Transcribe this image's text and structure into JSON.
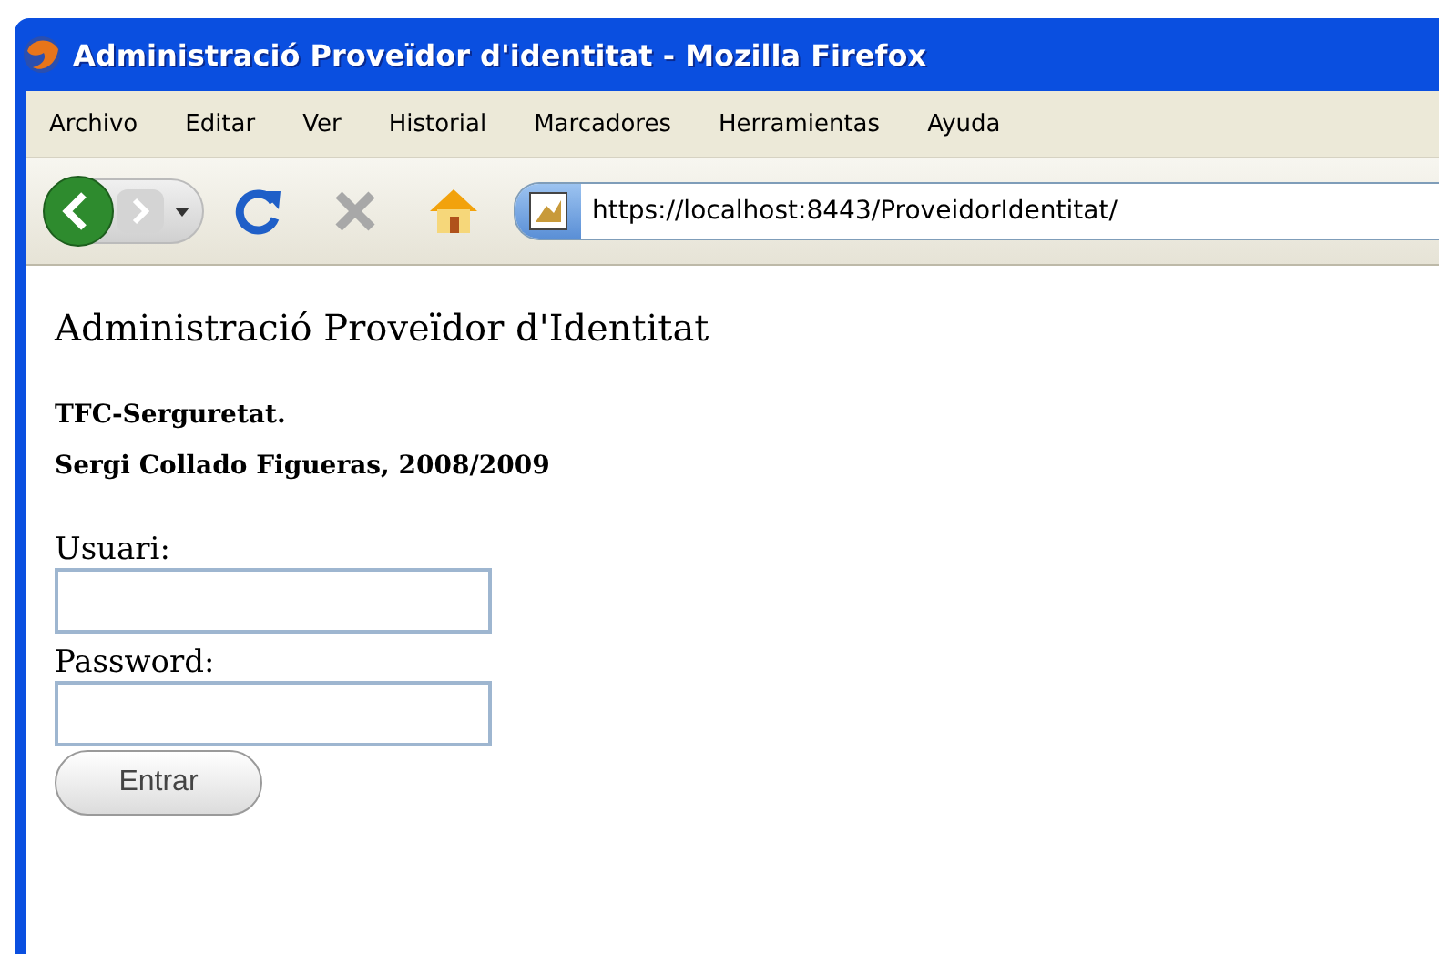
{
  "window": {
    "title": "Administració Proveïdor d'identitat - Mozilla Firefox"
  },
  "menu": [
    {
      "label": "Archivo"
    },
    {
      "label": "Editar"
    },
    {
      "label": "Ver"
    },
    {
      "label": "Historial"
    },
    {
      "label": "Marcadores"
    },
    {
      "label": "Herramientas"
    },
    {
      "label": "Ayuda"
    }
  ],
  "toolbar": {
    "back_enabled": true,
    "forward_enabled": false,
    "address": "https://localhost:8443/ProveidorIdentitat/"
  },
  "page": {
    "heading": "Administració Proveïdor d'Identitat",
    "subtitles": [
      "TFC-Serguretat.",
      "Sergi Collado Figueras, 2008/2009"
    ],
    "fields": [
      {
        "label": "Usuari:"
      },
      {
        "label": "Password:"
      }
    ],
    "button": "Entrar"
  }
}
